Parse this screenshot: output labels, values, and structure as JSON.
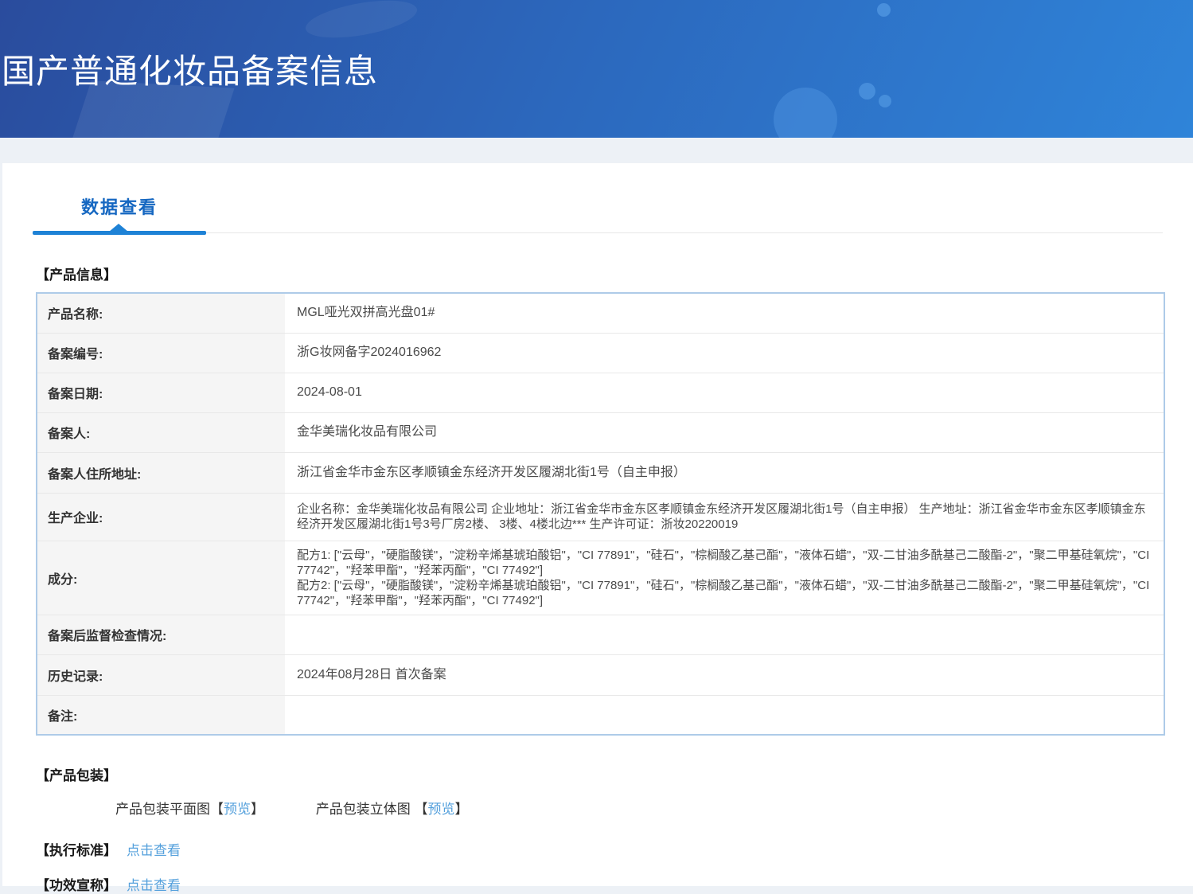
{
  "banner": {
    "title": "国产普通化妆品备案信息"
  },
  "tabs": {
    "data_view": "数据查看"
  },
  "product_info": {
    "section_title": "【产品信息】",
    "rows": [
      {
        "label": "产品名称:",
        "value": "MGL哑光双拼高光盘01#"
      },
      {
        "label": "备案编号:",
        "value": "浙G妆网备字2024016962"
      },
      {
        "label": "备案日期:",
        "value": "2024-08-01"
      },
      {
        "label": "备案人:",
        "value": "金华美瑞化妆品有限公司"
      },
      {
        "label": "备案人住所地址:",
        "value": "浙江省金华市金东区孝顺镇金东经济开发区履湖北街1号（自主申报）"
      },
      {
        "label": "生产企业:",
        "value": "企业名称：金华美瑞化妆品有限公司 企业地址：浙江省金华市金东区孝顺镇金东经济开发区履湖北街1号（自主申报） 生产地址：浙江省金华市金东区孝顺镇金东经济开发区履湖北街1号3号厂房2楼、 3楼、4楼北边*** 生产许可证：浙妆20220019"
      },
      {
        "label": "成分:",
        "value": "配方1: [\"云母\"，\"硬脂酸镁\"，\"淀粉辛烯基琥珀酸铝\"，\"CI 77891\"，\"硅石\"，\"棕榈酸乙基己酯\"，\"液体石蜡\"，\"双-二甘油多酰基己二酸酯-2\"，\"聚二甲基硅氧烷\"，\"CI 77742\"，\"羟苯甲酯\"，\"羟苯丙酯\"，\"CI 77492\"]\n配方2: [\"云母\"，\"硬脂酸镁\"，\"淀粉辛烯基琥珀酸铝\"，\"CI 77891\"，\"硅石\"，\"棕榈酸乙基己酯\"，\"液体石蜡\"，\"双-二甘油多酰基己二酸酯-2\"，\"聚二甲基硅氧烷\"，\"CI 77742\"，\"羟苯甲酯\"，\"羟苯丙酯\"，\"CI 77492\"]"
      },
      {
        "label": "备案后监督检查情况:",
        "value": ""
      },
      {
        "label": "历史记录:",
        "value": "2024年08月28日 首次备案"
      },
      {
        "label": "备注:",
        "value": ""
      }
    ]
  },
  "packaging": {
    "section_title": "【产品包装】",
    "bracket_open": "【",
    "bracket_close": "】",
    "items": [
      {
        "label": "产品包装平面图",
        "action": "预览"
      },
      {
        "label": "产品包装立体图 ",
        "action": "预览"
      }
    ]
  },
  "standards": {
    "label": "【执行标准】",
    "link": "点击查看"
  },
  "efficacy": {
    "label": "【功效宣称】",
    "link": "点击查看"
  },
  "colors": {
    "tab_blue": "#1567c1",
    "underline_blue": "#1e82d6",
    "link_blue": "#54a0dc",
    "table_border_blue": "#aecbe8",
    "banner_top": "#2a4c9d",
    "banner_bottom": "#2f84d9"
  }
}
